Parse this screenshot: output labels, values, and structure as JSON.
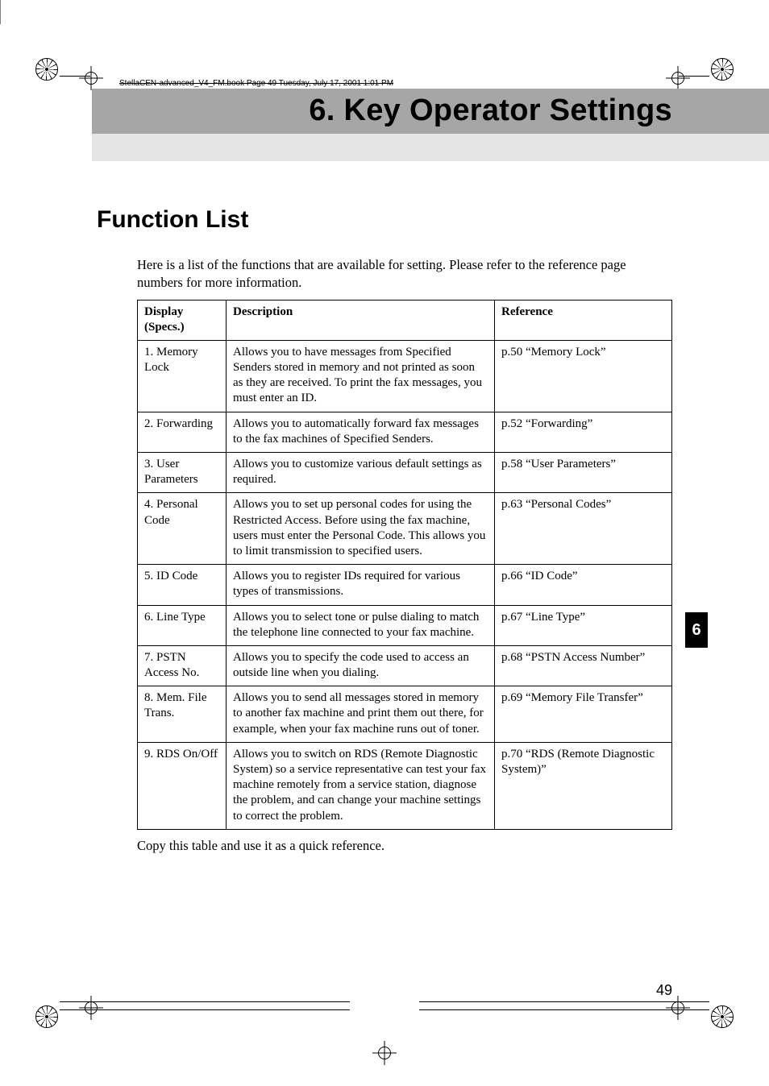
{
  "slug_line": "StellaCEN-advanced_V4_FM.book  Page 49  Tuesday, July 17, 2001  1:01 PM",
  "chapter_title": "6. Key Operator Settings",
  "section_title": "Function List",
  "lead_paragraph": "Here is a list of the functions that are available for setting. Please refer to the reference page numbers for more information.",
  "table": {
    "headers": {
      "display": "Display (Specs.)",
      "description": "Description",
      "reference": "Reference"
    },
    "rows": [
      {
        "display": "1. Memory Lock",
        "description": "Allows you to have messages from Specified Senders stored in memory and not printed as soon as they are received. To print the fax messages, you must enter an ID.",
        "reference": "p.50 “Memory Lock”"
      },
      {
        "display": "2. Forwarding",
        "description": "Allows you to automatically forward fax messages to the fax machines of Specified Senders.",
        "reference": "p.52 “Forwarding”"
      },
      {
        "display": "3. User Parameters",
        "description": "Allows you to customize various default settings as required.",
        "reference": "p.58 “User Parameters”"
      },
      {
        "display": "4. Personal Code",
        "description": "Allows you to set up personal codes for using the Restricted Access. Before using the fax machine, users must enter the Personal Code. This allows you to limit transmission to specified users.",
        "reference": "p.63 “Personal Codes”"
      },
      {
        "display": "5. ID Code",
        "description": "Allows you to register IDs required for various types of transmissions.",
        "reference": "p.66 “ID Code”"
      },
      {
        "display": "6. Line Type",
        "description": "Allows you to select tone or pulse dialing to match the telephone line connected to your fax machine.",
        "reference": "p.67 “Line Type”"
      },
      {
        "display": "7. PSTN Access No.",
        "description": "Allows you to specify the code used to access an outside line when you dialing.",
        "reference": "p.68 “PSTN Access Number”"
      },
      {
        "display": "8. Mem. File Trans.",
        "description": "Allows you to send all messages stored in memory to another fax machine and print them out there, for example, when your fax machine runs out of toner.",
        "reference": "p.69 “Memory File Transfer”"
      },
      {
        "display": "9. RDS On/Off",
        "description": "Allows you to switch on RDS (Remote Diagnostic System) so a service representative can test your fax machine remotely from a service station, diagnose the problem, and can change your machine settings to correct the problem.",
        "reference": "p.70 “RDS (Remote Diagnostic System)”"
      }
    ]
  },
  "after_table": "Copy this table and use it as a quick reference.",
  "index_tab": "6",
  "page_number": "49"
}
